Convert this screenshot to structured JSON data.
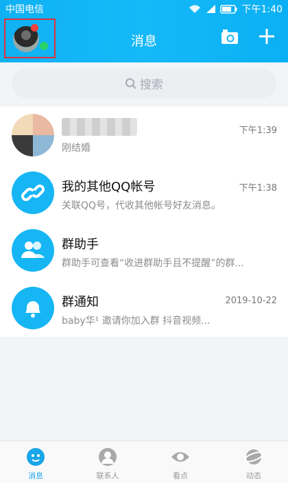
{
  "status_bar": {
    "carrier": "中国电信",
    "time": "下午1:40"
  },
  "header": {
    "title": "消息"
  },
  "search": {
    "placeholder": "搜索"
  },
  "conversations": [
    {
      "name": "",
      "subtitle": "刚结婚",
      "time": "下午1:39"
    },
    {
      "name": "我的其他QQ帐号",
      "subtitle": "关联QQ号，代收其他帐号好友消息。",
      "time": "下午1:38"
    },
    {
      "name": "群助手",
      "subtitle": "群助手可查看“收进群助手且不提醒”的群...",
      "time": ""
    },
    {
      "name": "群通知",
      "subtitle": "baby华¹ 邀请你加入群 抖音视频...",
      "time": "2019-10-22"
    }
  ],
  "bottom_nav": [
    {
      "label": "消息",
      "icon": "message-icon"
    },
    {
      "label": "联系人",
      "icon": "contacts-icon"
    },
    {
      "label": "看点",
      "icon": "eye-icon"
    },
    {
      "label": "动态",
      "icon": "planet-icon"
    }
  ],
  "colors": {
    "accent": "#16b6f4",
    "unread_dot": "#f2413a",
    "online_dot": "#29d36b"
  }
}
